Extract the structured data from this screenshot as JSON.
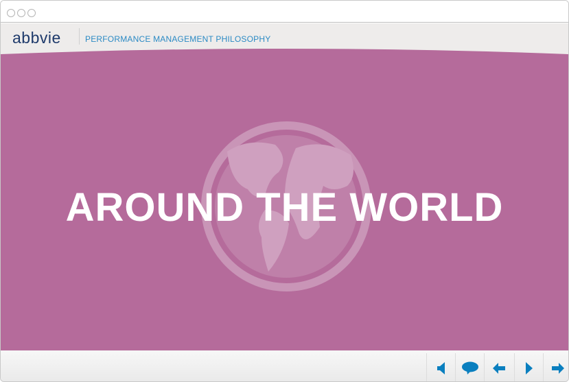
{
  "header": {
    "logo": "abbvie",
    "title": "PERFORMANCE MANAGEMENT PHILOSOPHY"
  },
  "slide": {
    "headline": "AROUND THE WORLD",
    "background": "#b56b9b"
  },
  "controls": [
    {
      "name": "audio",
      "icon": "speaker-icon"
    },
    {
      "name": "transcript",
      "icon": "speech-bubble-icon"
    },
    {
      "name": "previous",
      "icon": "arrow-left-icon"
    },
    {
      "name": "play",
      "icon": "play-icon"
    },
    {
      "name": "next",
      "icon": "arrow-right-icon"
    }
  ],
  "colors": {
    "accent": "#0a7fbf",
    "brand": "#1e3a6b"
  }
}
